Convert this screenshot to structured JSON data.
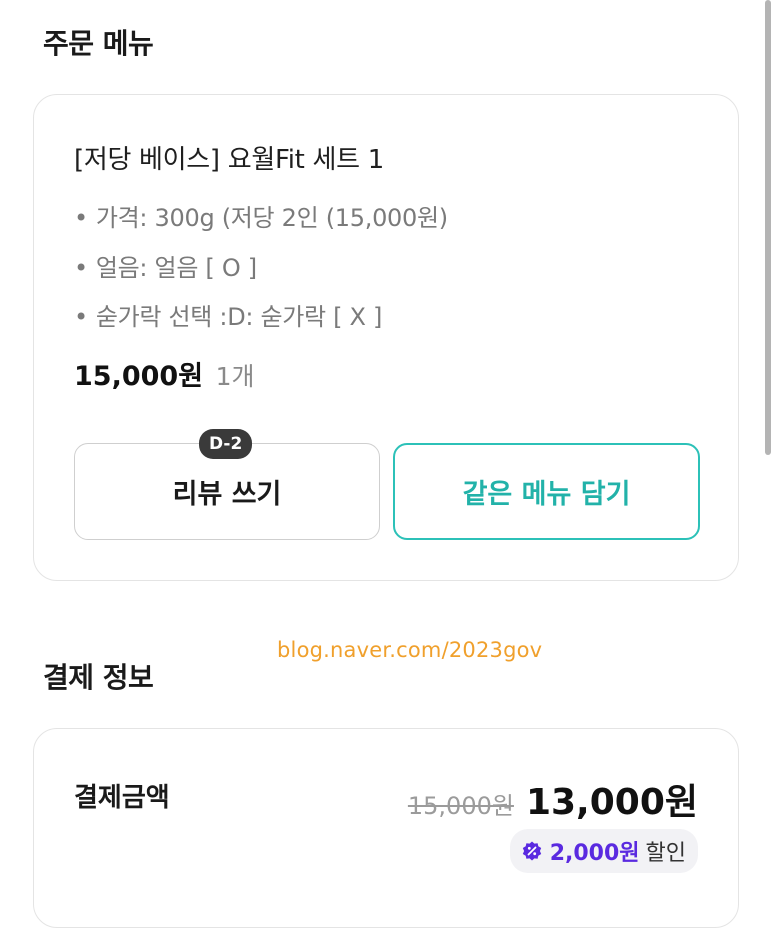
{
  "order_section": {
    "title": "주문 메뉴",
    "item": {
      "name": "[저당 베이스] 요월Fit 세트 1",
      "options": [
        "가격: 300g (저당 2인 (15,000원)",
        "얼음: 얼음 [ O ]",
        "숟가락 선택 :D: 숟가락 [ X ]"
      ],
      "option_bullet": "•",
      "price": "15,000원",
      "quantity": "1개"
    },
    "buttons": {
      "review_label": "리뷰 쓰기",
      "review_badge": "D-2",
      "same_menu_label": "같은 메뉴 담기"
    }
  },
  "watermark": "blog.naver.com/2023gov",
  "payment_section": {
    "title": "결제 정보",
    "amount_label": "결제금액",
    "original_price": "15,000원",
    "final_price": "13,000원",
    "discount_amount": "2,000원",
    "discount_label": "할인"
  },
  "colors": {
    "accent": "#2cc1b8",
    "discount": "#5a2ae0",
    "watermark": "#f0a02c"
  }
}
